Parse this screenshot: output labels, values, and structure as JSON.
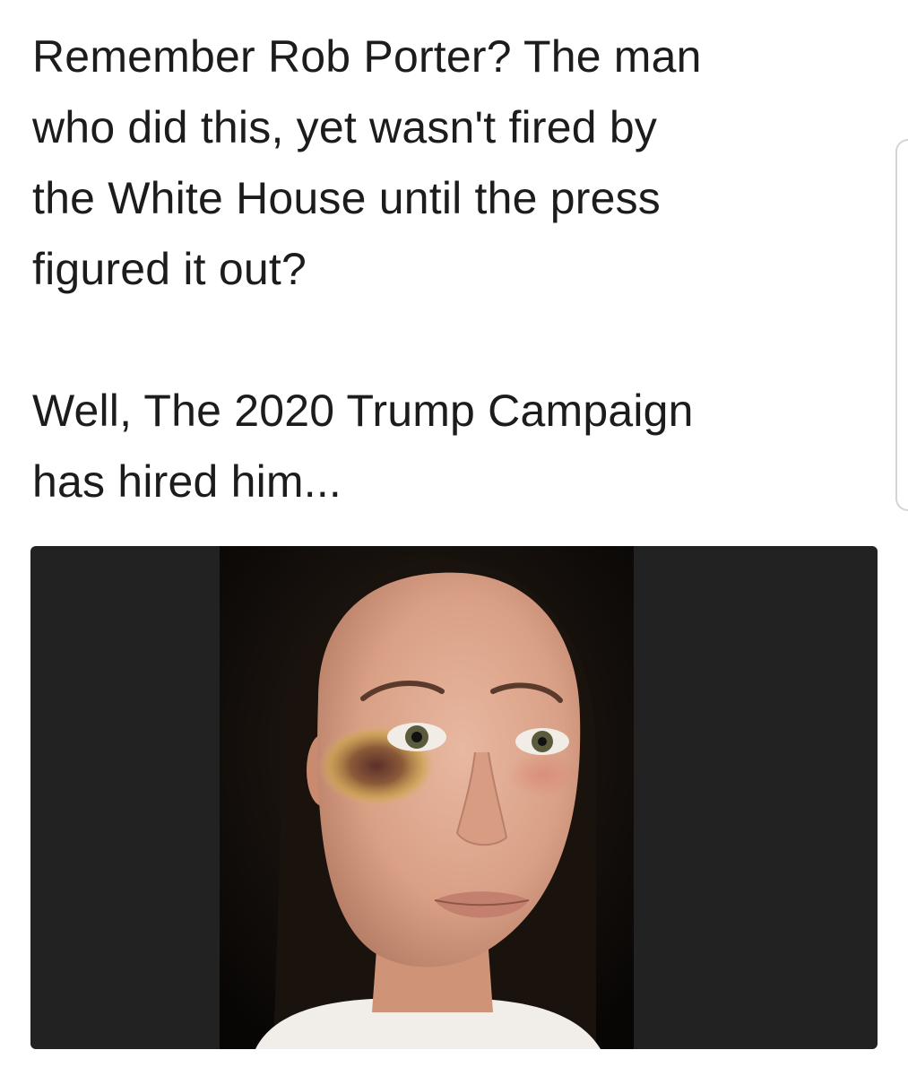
{
  "post": {
    "paragraph_1": [
      "Remember Rob Porter?  The man",
      "who did this, yet wasn't fired by",
      "the White House until the press",
      "figured it out?"
    ],
    "paragraph_2": [
      "Well, The 2020 Trump Campaign",
      "has hired him..."
    ]
  },
  "media": {
    "photo_subject": "woman-with-bruised-eye",
    "card_background": "#222222"
  },
  "colors": {
    "text": "#1c1c1c",
    "background": "#ffffff"
  }
}
